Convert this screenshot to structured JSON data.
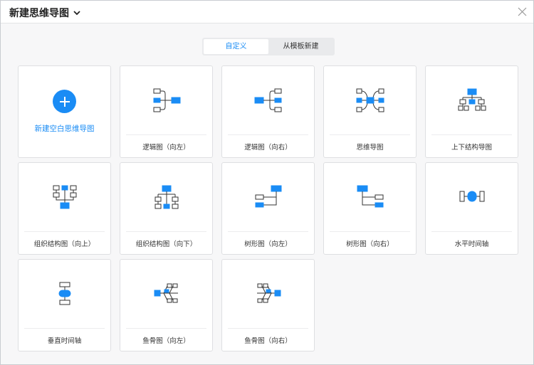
{
  "header": {
    "title": "新建思维导图",
    "icons": {
      "title_chevron": "chevron-down-icon",
      "close": "close-icon"
    }
  },
  "tabs": [
    {
      "label": "自定义",
      "active": true
    },
    {
      "label": "从模板新建",
      "active": false
    }
  ],
  "blank": {
    "label": "新建空白思维导图",
    "icon": "plus-circle-icon"
  },
  "templates": [
    {
      "label": "逻辑图（向左）",
      "icon": "logic-left-icon"
    },
    {
      "label": "逻辑图（向右）",
      "icon": "logic-right-icon"
    },
    {
      "label": "思维导图",
      "icon": "mindmap-icon"
    },
    {
      "label": "上下结构导图",
      "icon": "top-down-icon"
    },
    {
      "label": "组织结构图（向上）",
      "icon": "org-up-icon"
    },
    {
      "label": "组织结构图（向下）",
      "icon": "org-down-icon"
    },
    {
      "label": "树形图（向左）",
      "icon": "tree-left-icon"
    },
    {
      "label": "树形图（向右）",
      "icon": "tree-right-icon"
    },
    {
      "label": "水平时间轴",
      "icon": "horizontal-timeline-icon"
    },
    {
      "label": "垂直时间轴",
      "icon": "vertical-timeline-icon"
    },
    {
      "label": "鱼骨图（向左）",
      "icon": "fishbone-left-icon"
    },
    {
      "label": "鱼骨图（向右）",
      "icon": "fishbone-right-icon"
    }
  ],
  "colors": {
    "accent": "#1a8cf5",
    "node_stroke": "#333333"
  }
}
